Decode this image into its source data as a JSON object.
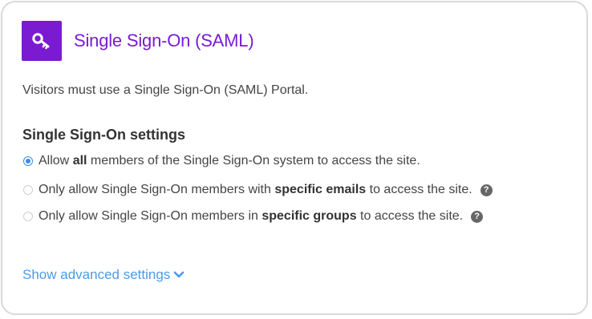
{
  "header": {
    "icon": "key-icon",
    "title": "Single Sign-On (SAML)"
  },
  "description": "Visitors must use a Single Sign-On (SAML) Portal.",
  "settings": {
    "heading": "Single Sign-On settings",
    "options": [
      {
        "selected": true,
        "pre": "Allow ",
        "bold": "all",
        "post": " members of the Single Sign-On system to access the site.",
        "help": false
      },
      {
        "selected": false,
        "pre": "Only allow Single Sign-On members with ",
        "bold": "specific emails",
        "post": " to access the site.",
        "help": true,
        "help_glyph": "?"
      },
      {
        "selected": false,
        "pre": "Only allow Single Sign-On members in ",
        "bold": "specific groups",
        "post": " to access the site.",
        "help": true,
        "help_glyph": "?"
      }
    ]
  },
  "advanced": {
    "label": "Show advanced settings",
    "icon": "chevron-down-icon"
  },
  "colors": {
    "accent_purple": "#7a1bd2",
    "link_blue": "#4a9be6",
    "radio_blue": "#3a8de0"
  }
}
